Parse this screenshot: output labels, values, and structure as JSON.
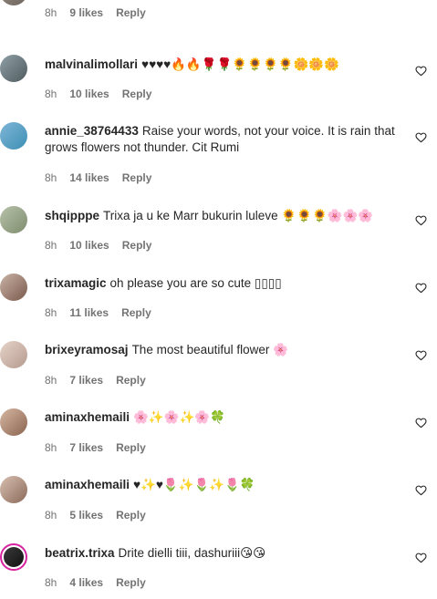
{
  "comments": [
    {
      "username": "",
      "text": "",
      "time": "8h",
      "likes": "9 likes",
      "reply": "Reply",
      "avatar_colors": [
        "#9a8f86",
        "#6e655e"
      ]
    },
    {
      "username": "malvinalimollari",
      "text": "♥♥♥♥🔥🔥🌹🌹🌻🌻🌻🌻🌼🌼🌼",
      "time": "8h",
      "likes": "10 likes",
      "reply": "Reply",
      "avatar_colors": [
        "#8fa0a6",
        "#4f5a5e"
      ]
    },
    {
      "username": "annie_38764433",
      "text": "Raise your words, not your voice. It is rain that grows flowers not thunder. Cit Rumi",
      "time": "8h",
      "likes": "14 likes",
      "reply": "Reply",
      "avatar_colors": [
        "#7fb6d6",
        "#3d8fb5"
      ]
    },
    {
      "username": "shqipppe",
      "text": "Trixa ja u ke Marr bukurin luleve 🌻🌻🌻🌸🌸🌸",
      "time": "8h",
      "likes": "10 likes",
      "reply": "Reply",
      "avatar_colors": [
        "#b7c2a9",
        "#7f8c6e"
      ]
    },
    {
      "username": "trixamagic",
      "text": "oh please you are so cute ▯▯▯▯",
      "time": "8h",
      "likes": "11 likes",
      "reply": "Reply",
      "avatar_colors": [
        "#c9b2a6",
        "#7a5a4c"
      ]
    },
    {
      "username": "brixeyramosaj",
      "text": "The most beautiful flower 🌸",
      "time": "8h",
      "likes": "7 likes",
      "reply": "Reply",
      "avatar_colors": [
        "#e6d3c9",
        "#b59a8e"
      ]
    },
    {
      "username": "aminaxhemaili",
      "text": "🌸✨🌸✨🌸🍀",
      "time": "8h",
      "likes": "7 likes",
      "reply": "Reply",
      "avatar_colors": [
        "#d6b7a2",
        "#8a6450"
      ]
    },
    {
      "username": "aminaxhemaili",
      "text": "♥✨♥🌷✨🌷✨🌷🍀",
      "time": "8h",
      "likes": "5 likes",
      "reply": "Reply",
      "avatar_colors": [
        "#d8bfb0",
        "#8a6a5a"
      ]
    },
    {
      "username": "beatrix.trixa",
      "text": "Drite dielli tiii, dashuriii😘😘",
      "time": "8h",
      "likes": "4 likes",
      "reply": "Reply",
      "avatar_colors": [
        "#3a3a3a",
        "#111111"
      ],
      "has_story_ring": true
    }
  ],
  "icons": {
    "like": "heart-outline-icon"
  },
  "colors": {
    "text": "#262626",
    "meta": "#737373",
    "story_ring": "#d6249f"
  }
}
